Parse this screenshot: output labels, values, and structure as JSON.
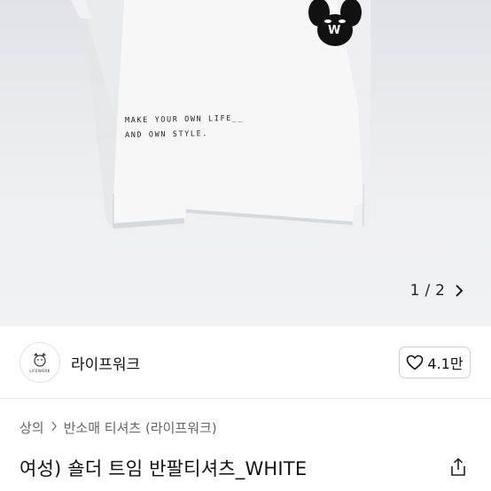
{
  "product_image": {
    "print_lines": [
      "MAKE YOUR OWN LIFE__",
      "AND OWN STYLE."
    ],
    "logo_letter": "W",
    "pager": {
      "current": "1",
      "separator": "/",
      "total": "2"
    }
  },
  "shop": {
    "name": "라이프워크",
    "logo_text": "LIFEWORK",
    "like_count": "4.1만"
  },
  "breadcrumb": {
    "items": [
      "상의",
      "반소매 티셔츠 (라이프워크)"
    ],
    "separator": ">"
  },
  "product": {
    "title": "여성) 숄더 트임 반팔티셔츠_WHITE"
  },
  "colors": {
    "background": "#ffffff",
    "image_bg": "#eeeff1",
    "border": "#d0d0d0",
    "text": "#111111",
    "muted": "#666666"
  }
}
